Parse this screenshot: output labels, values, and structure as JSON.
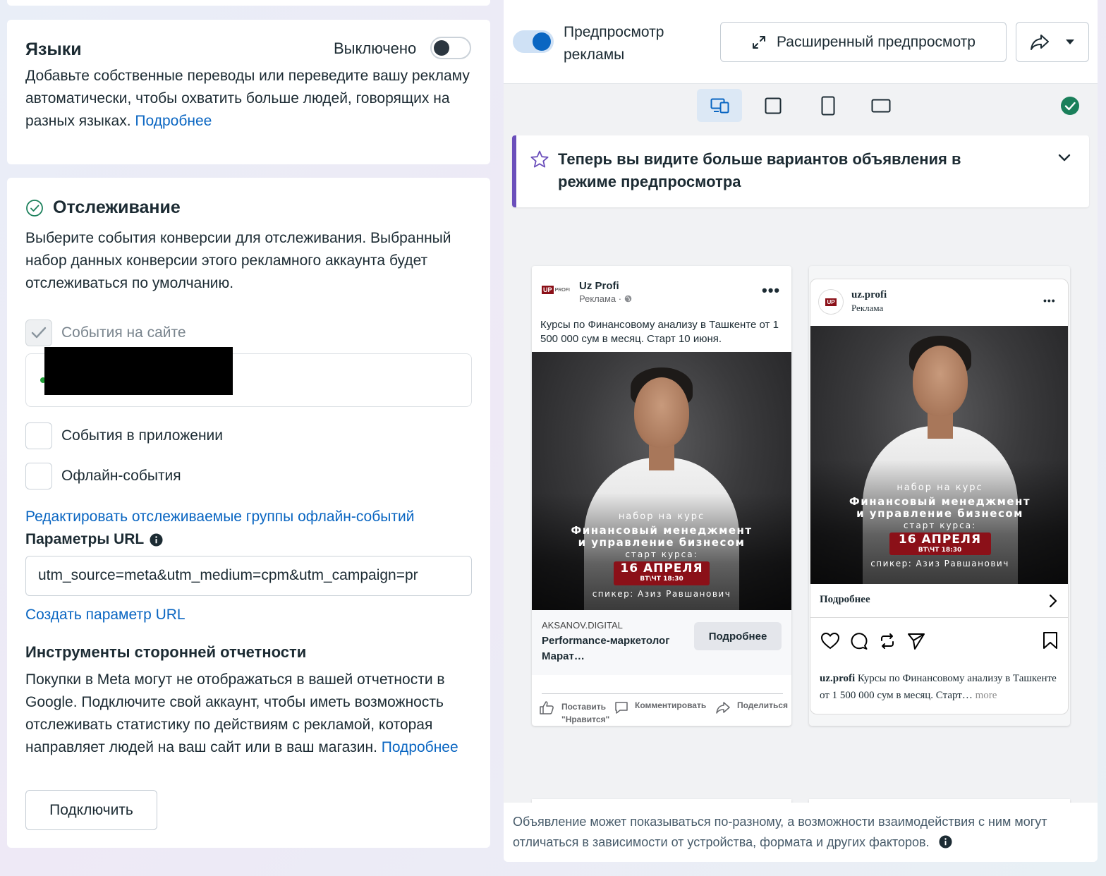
{
  "languages": {
    "title": "Языки",
    "toggle_label": "Выключено",
    "description": "Добавьте собственные переводы или переведите вашу рекламу автоматически, чтобы охватить больше людей, говорящих на разных языках.",
    "learn_more": "Подробнее"
  },
  "tracking": {
    "title": "Отслеживание",
    "description": "Выберите события конверсии для отслеживания. Выбранный набор данных конверсии этого рекламного аккаунта будет отслеживаться по умолчанию.",
    "website_events": "События на сайте",
    "app_events": "События в приложении",
    "offline_events": "Офлайн-события",
    "edit_offline_link": "Редактировать отслеживаемые группы офлайн-событий",
    "url_params_label": "Параметры URL",
    "url_params_value": "utm_source=meta&utm_medium=cpm&utm_campaign=pr",
    "create_url_param": "Создать параметр URL",
    "third_party_title": "Инструменты сторонней отчетности",
    "third_party_text": "Покупки в Meta могут не отображаться в вашей отчетности в Google. Подключите свой аккаунт, чтобы иметь возможность отслеживать статистику по действиям с рекламой, которая направляет людей на ваш сайт или в ваш магазин.",
    "third_party_learn_more": "Подробнее",
    "connect_button": "Подключить"
  },
  "preview": {
    "toggle_label": "Предпросмотр рекламы",
    "advanced_button": "Расширенный предпросмотр",
    "notice": "Теперь вы видите больше вариантов объявления в режиме предпросмотра",
    "footer_note": "Объявление может показываться по-разному, а возможности взаимодействия с ним могут отличаться в зависимости от устройства, формата и других факторов."
  },
  "fb_post": {
    "page_name": "Uz Profi",
    "sponsored": "Реклама ·",
    "text": "Курсы по Финансовому анализу в Ташкенте от 1 500 000 сум в месяц. Старт 10 июня.",
    "domain": "AKSANOV.DIGITAL",
    "headline": "Performance-маркетолог Марат…",
    "cta": "Подробнее",
    "like": "Поставить \"Нравится\"",
    "comment": "Комментировать",
    "share": "Поделиться"
  },
  "ig_post": {
    "username": "uz.profi",
    "sponsored": "Реклама",
    "cta": "Подробнее",
    "caption_user": "uz.profi",
    "caption": "Курсы по Финансовому анализу в Ташкенте от 1 500 000 сум в месяц. Старт…",
    "more": "more"
  },
  "creative": {
    "kicker": "набор на курс",
    "line1": "Финансовый менеджмент",
    "line2": "и управление бизнесом",
    "start": "старт курса:",
    "date": "16 АПРЕЛЯ",
    "time": "ВТ\\ЧТ 18:30",
    "speaker": "спикер: Азиз Равшанович",
    "logo": "UP PROFI"
  },
  "colors": {
    "link": "#0a66c2",
    "accent_purple": "#6b4fbb",
    "success_green": "#1a7f5a",
    "date_red": "#8b1018"
  }
}
